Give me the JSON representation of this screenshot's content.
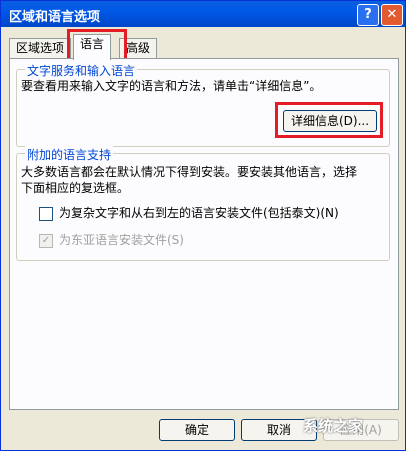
{
  "window": {
    "title": "区域和语言选项",
    "help_glyph": "?",
    "close_glyph": "✕"
  },
  "tabs": [
    {
      "label": "区域选项",
      "active": false
    },
    {
      "label": "语言",
      "active": true
    },
    {
      "label": "高级",
      "active": false
    }
  ],
  "text_services": {
    "legend": "文字服务和输入语言",
    "description": "要查看用来输入文字的语言和方法，请单击“详细信息”。",
    "details_button": "详细信息(D)..."
  },
  "supplemental": {
    "legend": "附加的语言支持",
    "description_line1": "大多数语言都会在默认情况下得到安装。要安装其他语言，选择",
    "description_line2": "下面相应的复选框。",
    "complex_script": {
      "label": "为复杂文字和从右到左的语言安装文件(包括泰文)(N)",
      "checked": false,
      "enabled": true
    },
    "east_asian": {
      "label": "为东亚语言安装文件(S)",
      "checked": true,
      "enabled": false
    }
  },
  "footer": {
    "ok": "确定",
    "cancel": "取消",
    "apply": "应用(A)"
  },
  "watermark": "系统之家",
  "colors": {
    "titlebar": "#0058e6",
    "highlight": "#e41c24",
    "legend": "#0046d5"
  }
}
